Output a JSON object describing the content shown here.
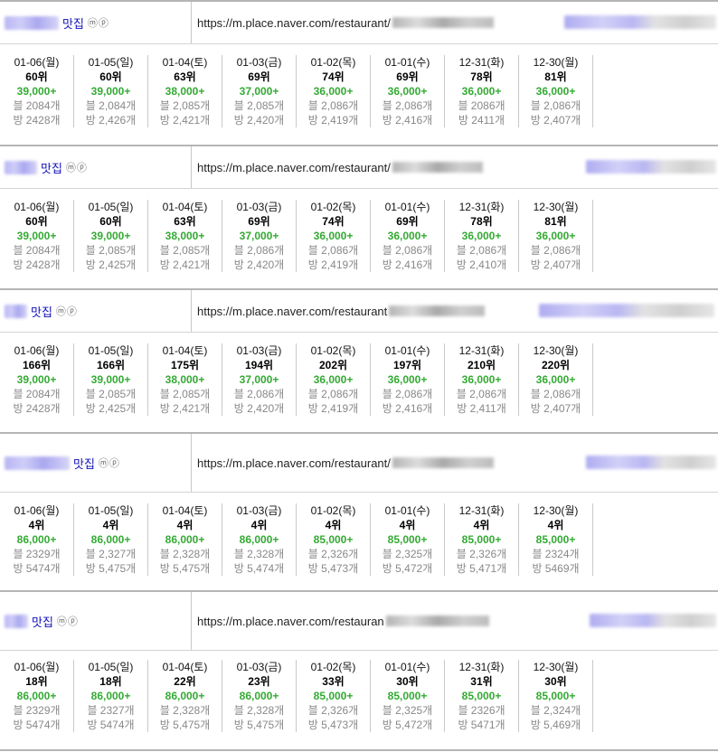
{
  "url_prefix": "https://m.place.naver.com/restaurant",
  "icons_label": "ⓜⓟ",
  "rows": [
    {
      "name": "맛집",
      "url_visible": "https://m.place.naver.com/restaurant/",
      "cells": [
        {
          "date": "01-06(월)",
          "rank": "60위",
          "volume": "39,000+",
          "blog": "블 2084개",
          "bang": "방 2428개"
        },
        {
          "date": "01-05(일)",
          "rank": "60위",
          "volume": "39,000+",
          "blog": "블 2,084개",
          "bang": "방 2,426개"
        },
        {
          "date": "01-04(토)",
          "rank": "63위",
          "volume": "38,000+",
          "blog": "블 2,085개",
          "bang": "방 2,421개"
        },
        {
          "date": "01-03(금)",
          "rank": "69위",
          "volume": "37,000+",
          "blog": "블 2,085개",
          "bang": "방 2,420개"
        },
        {
          "date": "01-02(목)",
          "rank": "74위",
          "volume": "36,000+",
          "blog": "블 2,086개",
          "bang": "방 2,419개"
        },
        {
          "date": "01-01(수)",
          "rank": "69위",
          "volume": "36,000+",
          "blog": "블 2,086개",
          "bang": "방 2,416개"
        },
        {
          "date": "12-31(화)",
          "rank": "78위",
          "volume": "36,000+",
          "blog": "블 2086개",
          "bang": "방 2411개"
        },
        {
          "date": "12-30(월)",
          "rank": "81위",
          "volume": "36,000+",
          "blog": "블 2,086개",
          "bang": "방 2,407개"
        }
      ]
    },
    {
      "name": "맛집",
      "url_visible": "https://m.place.naver.com/restaurant/",
      "cells": [
        {
          "date": "01-06(월)",
          "rank": "60위",
          "volume": "39,000+",
          "blog": "블 2084개",
          "bang": "방 2428개"
        },
        {
          "date": "01-05(일)",
          "rank": "60위",
          "volume": "39,000+",
          "blog": "블 2,085개",
          "bang": "방 2,425개"
        },
        {
          "date": "01-04(토)",
          "rank": "63위",
          "volume": "38,000+",
          "blog": "블 2,085개",
          "bang": "방 2,421개"
        },
        {
          "date": "01-03(금)",
          "rank": "69위",
          "volume": "37,000+",
          "blog": "블 2,086개",
          "bang": "방 2,420개"
        },
        {
          "date": "01-02(목)",
          "rank": "74위",
          "volume": "36,000+",
          "blog": "블 2,086개",
          "bang": "방 2,419개"
        },
        {
          "date": "01-01(수)",
          "rank": "69위",
          "volume": "36,000+",
          "blog": "블 2,086개",
          "bang": "방 2,416개"
        },
        {
          "date": "12-31(화)",
          "rank": "78위",
          "volume": "36,000+",
          "blog": "블 2,086개",
          "bang": "방 2,410개"
        },
        {
          "date": "12-30(월)",
          "rank": "81위",
          "volume": "36,000+",
          "blog": "블 2,086개",
          "bang": "방 2,407개"
        }
      ]
    },
    {
      "name": "맛집",
      "url_visible": "https://m.place.naver.com/restaurant",
      "cells": [
        {
          "date": "01-06(월)",
          "rank": "166위",
          "volume": "39,000+",
          "blog": "블 2084개",
          "bang": "방 2428개"
        },
        {
          "date": "01-05(일)",
          "rank": "166위",
          "volume": "39,000+",
          "blog": "블 2,085개",
          "bang": "방 2,425개"
        },
        {
          "date": "01-04(토)",
          "rank": "175위",
          "volume": "38,000+",
          "blog": "블 2,085개",
          "bang": "방 2,421개"
        },
        {
          "date": "01-03(금)",
          "rank": "194위",
          "volume": "37,000+",
          "blog": "블 2,086개",
          "bang": "방 2,420개"
        },
        {
          "date": "01-02(목)",
          "rank": "202위",
          "volume": "36,000+",
          "blog": "블 2,086개",
          "bang": "방 2,419개"
        },
        {
          "date": "01-01(수)",
          "rank": "197위",
          "volume": "36,000+",
          "blog": "블 2,086개",
          "bang": "방 2,416개"
        },
        {
          "date": "12-31(화)",
          "rank": "210위",
          "volume": "36,000+",
          "blog": "블 2,086개",
          "bang": "방 2,411개"
        },
        {
          "date": "12-30(월)",
          "rank": "220위",
          "volume": "36,000+",
          "blog": "블 2,086개",
          "bang": "방 2,407개"
        }
      ]
    },
    {
      "name": "맛집",
      "url_visible": "https://m.place.naver.com/restaurant/",
      "cells": [
        {
          "date": "01-06(월)",
          "rank": "4위",
          "volume": "86,000+",
          "blog": "블 2329개",
          "bang": "방 5474개"
        },
        {
          "date": "01-05(일)",
          "rank": "4위",
          "volume": "86,000+",
          "blog": "블 2,327개",
          "bang": "방 5,475개"
        },
        {
          "date": "01-04(토)",
          "rank": "4위",
          "volume": "86,000+",
          "blog": "블 2,328개",
          "bang": "방 5,475개"
        },
        {
          "date": "01-03(금)",
          "rank": "4위",
          "volume": "86,000+",
          "blog": "블 2,328개",
          "bang": "방 5,474개"
        },
        {
          "date": "01-02(목)",
          "rank": "4위",
          "volume": "85,000+",
          "blog": "블 2,326개",
          "bang": "방 5,473개"
        },
        {
          "date": "01-01(수)",
          "rank": "4위",
          "volume": "85,000+",
          "blog": "블 2,325개",
          "bang": "방 5,472개"
        },
        {
          "date": "12-31(화)",
          "rank": "4위",
          "volume": "85,000+",
          "blog": "블 2,326개",
          "bang": "방 5,471개"
        },
        {
          "date": "12-30(월)",
          "rank": "4위",
          "volume": "85,000+",
          "blog": "블 2324개",
          "bang": "방 5469개"
        }
      ]
    },
    {
      "name": "맛집",
      "url_visible": "https://m.place.naver.com/restauran",
      "cells": [
        {
          "date": "01-06(월)",
          "rank": "18위",
          "volume": "86,000+",
          "blog": "블 2329개",
          "bang": "방 5474개"
        },
        {
          "date": "01-05(일)",
          "rank": "18위",
          "volume": "86,000+",
          "blog": "블 2327개",
          "bang": "방 5474개"
        },
        {
          "date": "01-04(토)",
          "rank": "22위",
          "volume": "86,000+",
          "blog": "블 2,328개",
          "bang": "방 5,475개"
        },
        {
          "date": "01-03(금)",
          "rank": "23위",
          "volume": "86,000+",
          "blog": "블 2,328개",
          "bang": "방 5,475개"
        },
        {
          "date": "01-02(목)",
          "rank": "33위",
          "volume": "85,000+",
          "blog": "블 2,326개",
          "bang": "방 5,473개"
        },
        {
          "date": "01-01(수)",
          "rank": "30위",
          "volume": "85,000+",
          "blog": "블 2,325개",
          "bang": "방 5,472개"
        },
        {
          "date": "12-31(화)",
          "rank": "31위",
          "volume": "85,000+",
          "blog": "블 2326개",
          "bang": "방 5471개"
        },
        {
          "date": "12-30(월)",
          "rank": "30위",
          "volume": "85,000+",
          "blog": "블 2,324개",
          "bang": "방 5,469개"
        }
      ]
    }
  ]
}
